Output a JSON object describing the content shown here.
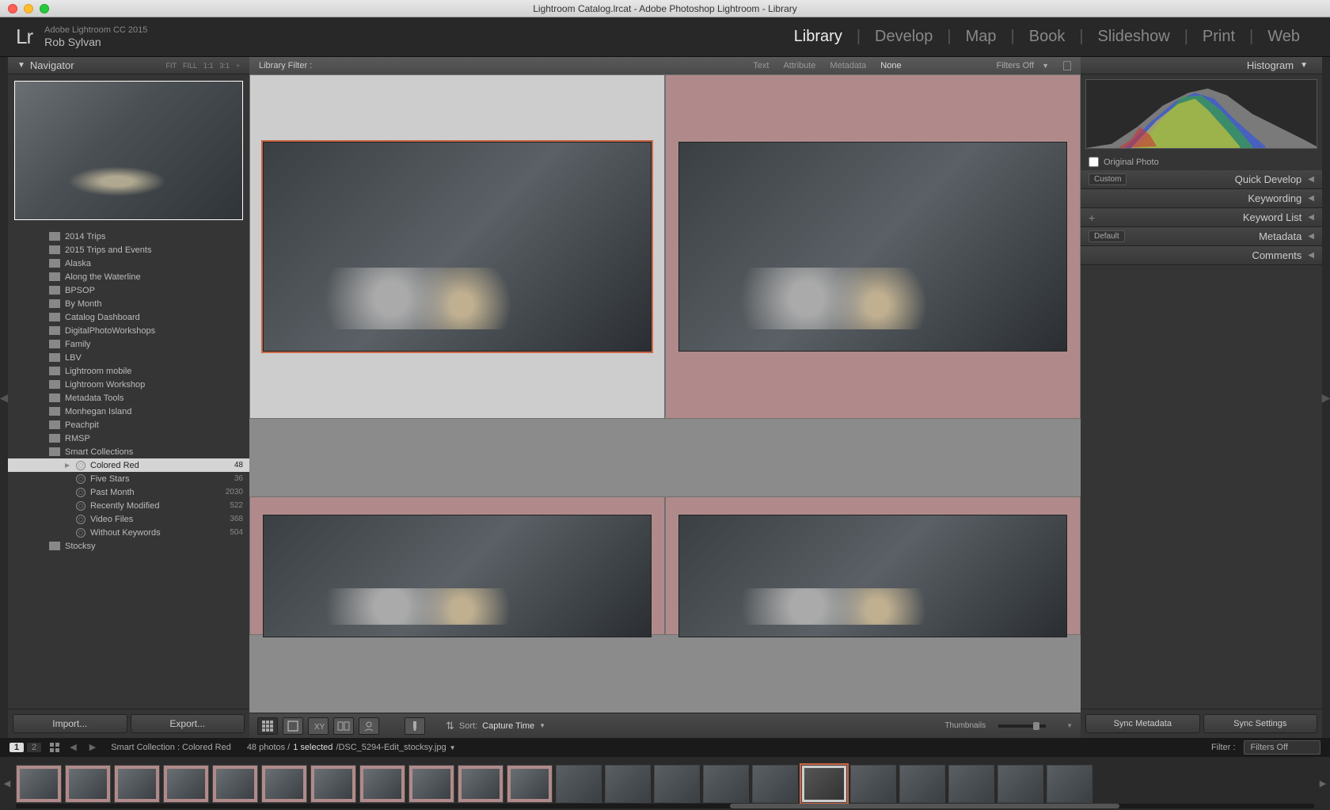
{
  "titlebar": "Lightroom Catalog.lrcat - Adobe Photoshop Lightroom - Library",
  "header": {
    "app_line": "Adobe Lightroom CC 2015",
    "user": "Rob Sylvan",
    "modules": [
      "Library",
      "Develop",
      "Map",
      "Book",
      "Slideshow",
      "Print",
      "Web"
    ],
    "active": "Library"
  },
  "navigator": {
    "title": "Navigator",
    "fit": "FIT",
    "fill": "FILL",
    "one": "1:1",
    "three": "3:1"
  },
  "folders": [
    {
      "name": "2014 Trips"
    },
    {
      "name": "2015 Trips and Events"
    },
    {
      "name": "Alaska"
    },
    {
      "name": "Along the Waterline"
    },
    {
      "name": "BPSOP"
    },
    {
      "name": "By Month"
    },
    {
      "name": "Catalog Dashboard"
    },
    {
      "name": "DigitalPhotoWorkshops"
    },
    {
      "name": "Family"
    },
    {
      "name": "LBV"
    },
    {
      "name": "Lightroom mobile"
    },
    {
      "name": "Lightroom Workshop"
    },
    {
      "name": "Metadata Tools"
    },
    {
      "name": "Monhegan Island"
    },
    {
      "name": "Peachpit"
    },
    {
      "name": "RMSP"
    },
    {
      "name": "Smart Collections",
      "open": true
    },
    {
      "name": "Stocksy"
    }
  ],
  "smart": [
    {
      "name": "Colored Red",
      "count": 48,
      "sel": true
    },
    {
      "name": "Five Stars",
      "count": 36
    },
    {
      "name": "Past Month",
      "count": 2030
    },
    {
      "name": "Recently Modified",
      "count": 522
    },
    {
      "name": "Video Files",
      "count": 368
    },
    {
      "name": "Without Keywords",
      "count": 504
    }
  ],
  "import_btn": "Import...",
  "export_btn": "Export...",
  "filterbar": {
    "label": "Library Filter :",
    "tabs": [
      "Text",
      "Attribute",
      "Metadata",
      "None"
    ],
    "active": "None",
    "filters_off": "Filters Off"
  },
  "toolbar": {
    "sort_lbl": "Sort:",
    "sort_val": "Capture Time",
    "thumbs": "Thumbnails"
  },
  "right": {
    "hist": "Histogram",
    "orig": "Original Photo",
    "custom": "Custom",
    "quick": "Quick Develop",
    "keywording": "Keywording",
    "keylist": "Keyword List",
    "default": "Default",
    "metadata": "Metadata",
    "comments": "Comments",
    "sync_meta": "Sync Metadata",
    "sync_set": "Sync Settings"
  },
  "status": {
    "page1": "1",
    "page2": "2",
    "path": "Smart Collection : Colored Red",
    "count": "48 photos /",
    "sel": "1 selected",
    "file": "/DSC_5294-Edit_stocksy.jpg",
    "filter_lbl": "Filter :",
    "filter_val": "Filters Off"
  }
}
